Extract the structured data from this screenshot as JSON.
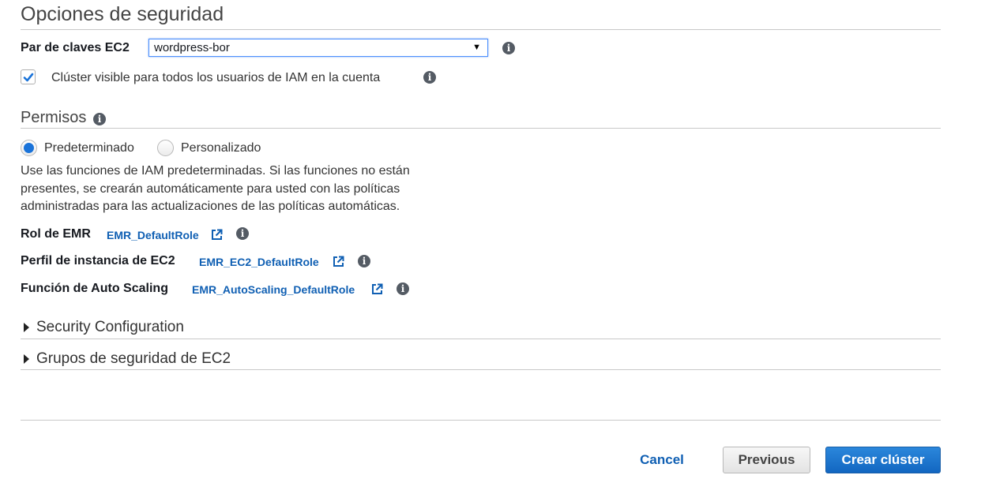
{
  "section": {
    "title": "Opciones de seguridad"
  },
  "keypair": {
    "label": "Par de claves EC2",
    "value": "wordpress-bor"
  },
  "visibility": {
    "checked": true,
    "label": "Clúster visible para todos los usuarios de IAM en la cuenta"
  },
  "permissions": {
    "title": "Permisos",
    "options": [
      {
        "label": "Predeterminado",
        "selected": true
      },
      {
        "label": "Personalizado",
        "selected": false
      }
    ],
    "description": "Use las funciones de IAM predeterminadas. Si las funciones no están presentes, se crearán automáticamente para usted con las políticas administradas para las actualizaciones de las políticas automáticas.",
    "roles": [
      {
        "label": "Rol de EMR",
        "link": "EMR_DefaultRole"
      },
      {
        "label": "Perfil de instancia de EC2",
        "link": "EMR_EC2_DefaultRole"
      },
      {
        "label": "Función de Auto Scaling",
        "link": "EMR_AutoScaling_DefaultRole"
      }
    ]
  },
  "expanders": [
    {
      "label": "Security Configuration",
      "expanded": false
    },
    {
      "label": "Grupos de seguridad de EC2",
      "expanded": false
    }
  ],
  "footer": {
    "cancel": "Cancel",
    "previous": "Previous",
    "create": "Crear clúster"
  },
  "icons": {
    "info": "info-icon",
    "external": "external-link-icon",
    "checkmark": "checkmark-icon",
    "dropdown": "dropdown-arrow-icon",
    "expand": "caret-right-icon"
  },
  "colors": {
    "link": "#0f5fb3",
    "primary_button": "#1266c1",
    "radio_selected": "#1a73d9",
    "checkmark": "#1a73d9"
  }
}
